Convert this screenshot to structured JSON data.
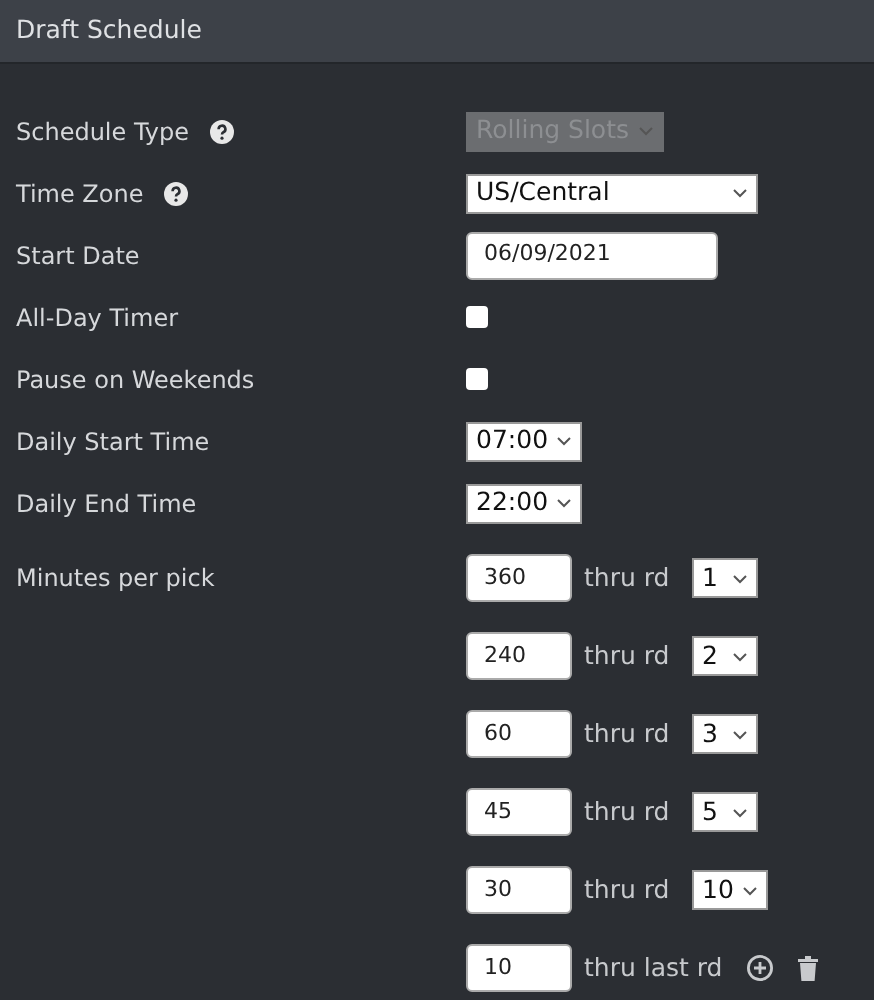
{
  "header": {
    "title": "Draft Schedule"
  },
  "fields": [
    {
      "kind": "select",
      "label": "Schedule Type",
      "help": true,
      "value": "Rolling Slots",
      "disabled": true
    },
    {
      "kind": "select",
      "label": "Time Zone",
      "help": true,
      "value": "US/Central",
      "disabled": false,
      "wide": true
    },
    {
      "kind": "date",
      "label": "Start Date",
      "help": false,
      "value": "06/09/2021"
    },
    {
      "kind": "checkbox",
      "label": "All-Day Timer",
      "help": false,
      "checked": false
    },
    {
      "kind": "checkbox",
      "label": "Pause on Weekends",
      "help": false,
      "checked": false
    },
    {
      "kind": "select",
      "label": "Daily Start Time",
      "help": false,
      "value": "07:00",
      "disabled": false
    },
    {
      "kind": "select",
      "label": "Daily End Time",
      "help": false,
      "value": "22:00",
      "disabled": false
    }
  ],
  "minutes_per_pick": {
    "label": "Minutes per pick",
    "rows": [
      {
        "kind": "round",
        "minutes": "360",
        "thru": "thru rd",
        "round": "1"
      },
      {
        "kind": "round",
        "minutes": "240",
        "thru": "thru rd",
        "round": "2"
      },
      {
        "kind": "round",
        "minutes": "60",
        "thru": "thru rd",
        "round": "3"
      },
      {
        "kind": "round",
        "minutes": "45",
        "thru": "thru rd",
        "round": "5"
      },
      {
        "kind": "round",
        "minutes": "30",
        "thru": "thru rd",
        "round": "10"
      },
      {
        "kind": "last",
        "minutes": "10",
        "thru": "thru last rd"
      }
    ]
  }
}
